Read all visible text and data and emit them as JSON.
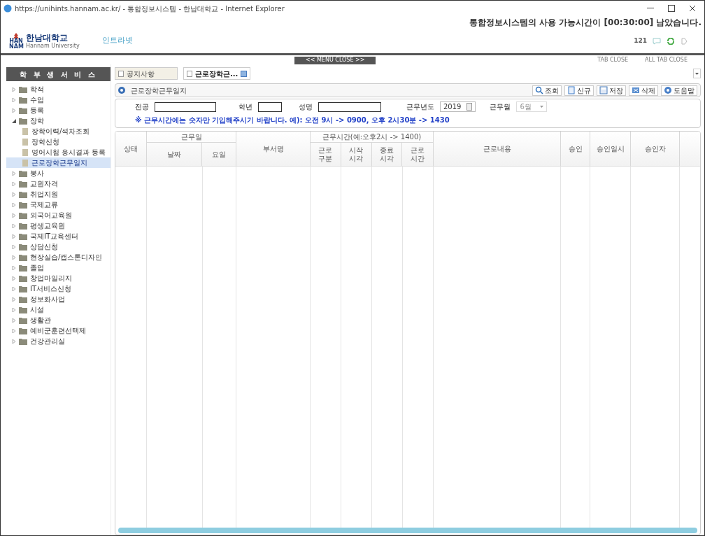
{
  "window": {
    "title": "https://unihints.hannam.ac.kr/ - 통합정보시스템 - 한남대학교 - Internet Explorer"
  },
  "session_notice": "통합정보시스템의 사용 가능시간이 [00:30:00] 남았습니다.",
  "header": {
    "logo_text": "한남대학교",
    "logo_sub": "Hannam University",
    "logo_mark": "HAN NAM",
    "nav_link": "인트라넷",
    "counter": "121"
  },
  "menu_close": "<< MENU CLOSE >>",
  "tab_close": "TAB CLOSE",
  "all_tab_close": "ALL TAB CLOSE",
  "sidebar": {
    "title": "학 부 생 서 비 스",
    "items": [
      {
        "label": "학적",
        "expanded": false,
        "selected": false
      },
      {
        "label": "수업",
        "expanded": false,
        "selected": false
      },
      {
        "label": "등록",
        "expanded": false,
        "selected": false
      },
      {
        "label": "장학",
        "expanded": true,
        "selected": false,
        "children": [
          {
            "label": "장학이력/석차조회",
            "selected": false
          },
          {
            "label": "장학신청",
            "selected": false
          },
          {
            "label": "영어시험 응시결과 등록",
            "selected": false
          },
          {
            "label": "근로장학근무일지",
            "selected": true
          }
        ]
      },
      {
        "label": "봉사",
        "expanded": false,
        "selected": false
      },
      {
        "label": "교원자격",
        "expanded": false,
        "selected": false
      },
      {
        "label": "취업지원",
        "expanded": false,
        "selected": false
      },
      {
        "label": "국제교류",
        "expanded": false,
        "selected": false
      },
      {
        "label": "외국어교육원",
        "expanded": false,
        "selected": false
      },
      {
        "label": "평생교육원",
        "expanded": false,
        "selected": false
      },
      {
        "label": "국제IT교육센터",
        "expanded": false,
        "selected": false
      },
      {
        "label": "상담신청",
        "expanded": false,
        "selected": false
      },
      {
        "label": "현장실습/캡스톤디자인",
        "expanded": false,
        "selected": false
      },
      {
        "label": "졸업",
        "expanded": false,
        "selected": false
      },
      {
        "label": "창업마일리지",
        "expanded": false,
        "selected": false
      },
      {
        "label": "IT서비스신청",
        "expanded": false,
        "selected": false
      },
      {
        "label": "정보화사업",
        "expanded": false,
        "selected": false
      },
      {
        "label": "시설",
        "expanded": false,
        "selected": false
      },
      {
        "label": "생활관",
        "expanded": false,
        "selected": false
      },
      {
        "label": "예비군훈련선택제",
        "expanded": false,
        "selected": false
      },
      {
        "label": "건강관리실",
        "expanded": false,
        "selected": false
      }
    ]
  },
  "tabs": [
    {
      "label": "공지사항",
      "selected": false
    },
    {
      "label": "근로장학근...",
      "selected": true
    }
  ],
  "panel": {
    "title": "근로장학근무일지",
    "toolbar": [
      {
        "label": "조회",
        "kind": "search"
      },
      {
        "label": "신규",
        "kind": "new"
      },
      {
        "label": "저장",
        "kind": "save"
      },
      {
        "label": "삭제",
        "kind": "delete"
      },
      {
        "label": "도움말",
        "kind": "help"
      }
    ]
  },
  "form": {
    "major_label": "전공",
    "grade_label": "학년",
    "name_label": "성명",
    "year_label": "근무년도",
    "year_value": "2019",
    "month_label": "근무월",
    "month_value": "6월",
    "note": "※ 근무시간에는 숫자만 기입해주시기 바랍니다. 예): 오전 9시 -> 0900, 오후 2시30분 -> 1430"
  },
  "table": {
    "col_status": "상태",
    "group_workday": "근무일",
    "col_date": "날짜",
    "col_weekday": "요일",
    "col_dept": "부서명",
    "group_time": "근무시간(예:오후2시 -> 1400)",
    "time_cols": [
      "근로\n구분",
      "시작\n시각",
      "종료\n시각",
      "근로\n시간"
    ],
    "col_content": "근로내용",
    "col_approve": "승인",
    "col_approve_time": "승인일시",
    "col_approver": "승인자"
  }
}
